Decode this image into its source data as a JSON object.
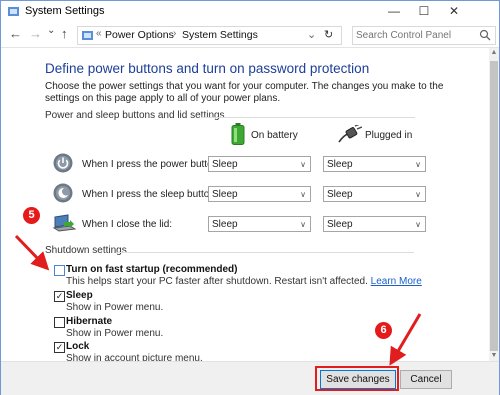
{
  "window": {
    "title": "System Settings",
    "controls": {
      "minimize": "—",
      "maximize": "☐",
      "close": "✕"
    }
  },
  "nav": {
    "back": "←",
    "forward": "→",
    "recent": "⌄",
    "up": "↑",
    "address_prefix": "«",
    "breadcrumbs": [
      "Power Options",
      "System Settings"
    ],
    "dropdown": "⌄",
    "refresh": "↻",
    "search_placeholder": "Search Control Panel"
  },
  "main": {
    "heading": "Define power buttons and turn on password protection",
    "description": "Choose the power settings that you want for your computer. The changes you make to the settings on this page apply to all of your power plans.",
    "buttons_section": {
      "label": "Power and sleep buttons and lid settings",
      "on_battery": "On battery",
      "plugged_in": "Plugged in",
      "rows": [
        {
          "label": "When I press the power button:",
          "on_battery": "Sleep",
          "plugged_in": "Sleep"
        },
        {
          "label": "When I press the sleep button:",
          "on_battery": "Sleep",
          "plugged_in": "Sleep"
        },
        {
          "label": "When I close the lid:",
          "on_battery": "Sleep",
          "plugged_in": "Sleep"
        }
      ]
    },
    "shutdown_section": {
      "label": "Shutdown settings",
      "items": [
        {
          "title": "Turn on fast startup (recommended)",
          "description": "This helps start your PC faster after shutdown. Restart isn't affected.",
          "link": "Learn More",
          "checked": false
        },
        {
          "title": "Sleep",
          "description": "Show in Power menu.",
          "checked": true
        },
        {
          "title": "Hibernate",
          "description": "Show in Power menu.",
          "checked": false
        },
        {
          "title": "Lock",
          "description": "Show in account picture menu.",
          "checked": true
        }
      ]
    }
  },
  "footer": {
    "save": "Save changes",
    "cancel": "Cancel"
  },
  "annotations": {
    "step5": "5",
    "step6": "6",
    "color": "#e11d1d"
  },
  "icons": {
    "app": "control-panel-icon",
    "power": "power-button-icon",
    "sleep": "moon-icon",
    "lid": "laptop-lid-icon",
    "battery": "battery-icon",
    "plug": "plug-icon",
    "search": "search-icon"
  },
  "colors": {
    "accent": "#1e3f98",
    "link": "#1a5fc9",
    "annotation": "#e11d1d",
    "battery": "#3fa835"
  }
}
